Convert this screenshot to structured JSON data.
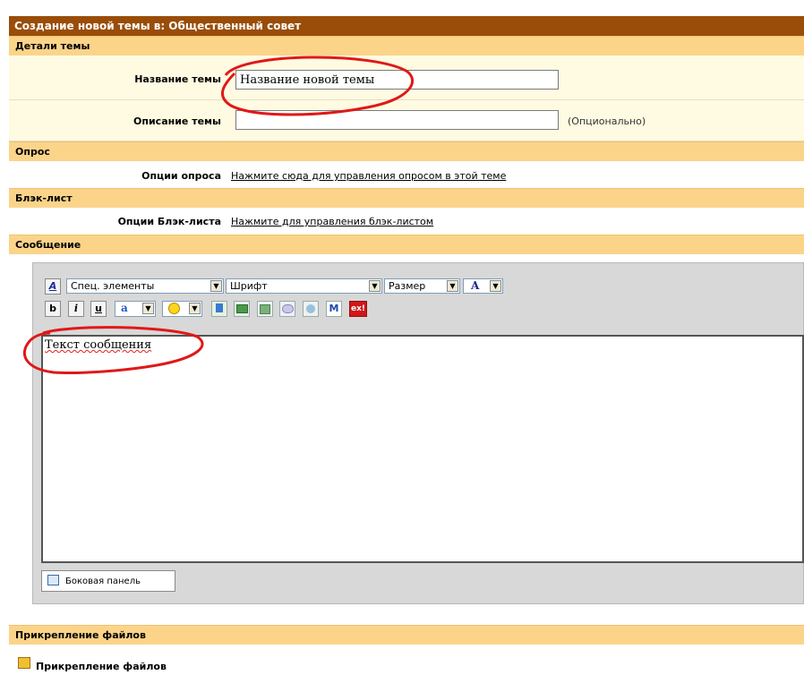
{
  "form": {
    "title": "Создание новой темы в: Общественный совет"
  },
  "sections": {
    "details": "Детали темы",
    "poll": "Опрос",
    "blacklist": "Блэк-лист",
    "message": "Сообщение",
    "attachments": "Прикрепление файлов"
  },
  "fields": {
    "topic_title_label": "Название темы",
    "topic_title_value": "Название новой темы",
    "topic_desc_label": "Описание темы",
    "topic_desc_value": "",
    "optional_note": "(Опционально)"
  },
  "poll": {
    "label": "Опции опроса",
    "link": "Нажмите сюда для управления опросом в этой теме"
  },
  "blacklist": {
    "label": "Опции Блэк-листа",
    "link": "Нажмите для управления блэк-листом"
  },
  "toolbar": {
    "special_elements": "Спец. элементы",
    "font": "Шрифт",
    "size": "Размер",
    "color_letter": "A",
    "bold": "b",
    "italic": "i",
    "underline": "u",
    "highlight": "a",
    "email": "M",
    "exl": "ex!"
  },
  "editor": {
    "message_text": "Текст сообщения",
    "side_panel_label": "Боковая панель"
  },
  "attachments": {
    "label": "Прикрепление файлов"
  },
  "colors": {
    "title_bg": "#994d08",
    "section_bg": "#fbd48a",
    "row_bg": "#fffbe2",
    "annotation": "#e01818"
  }
}
